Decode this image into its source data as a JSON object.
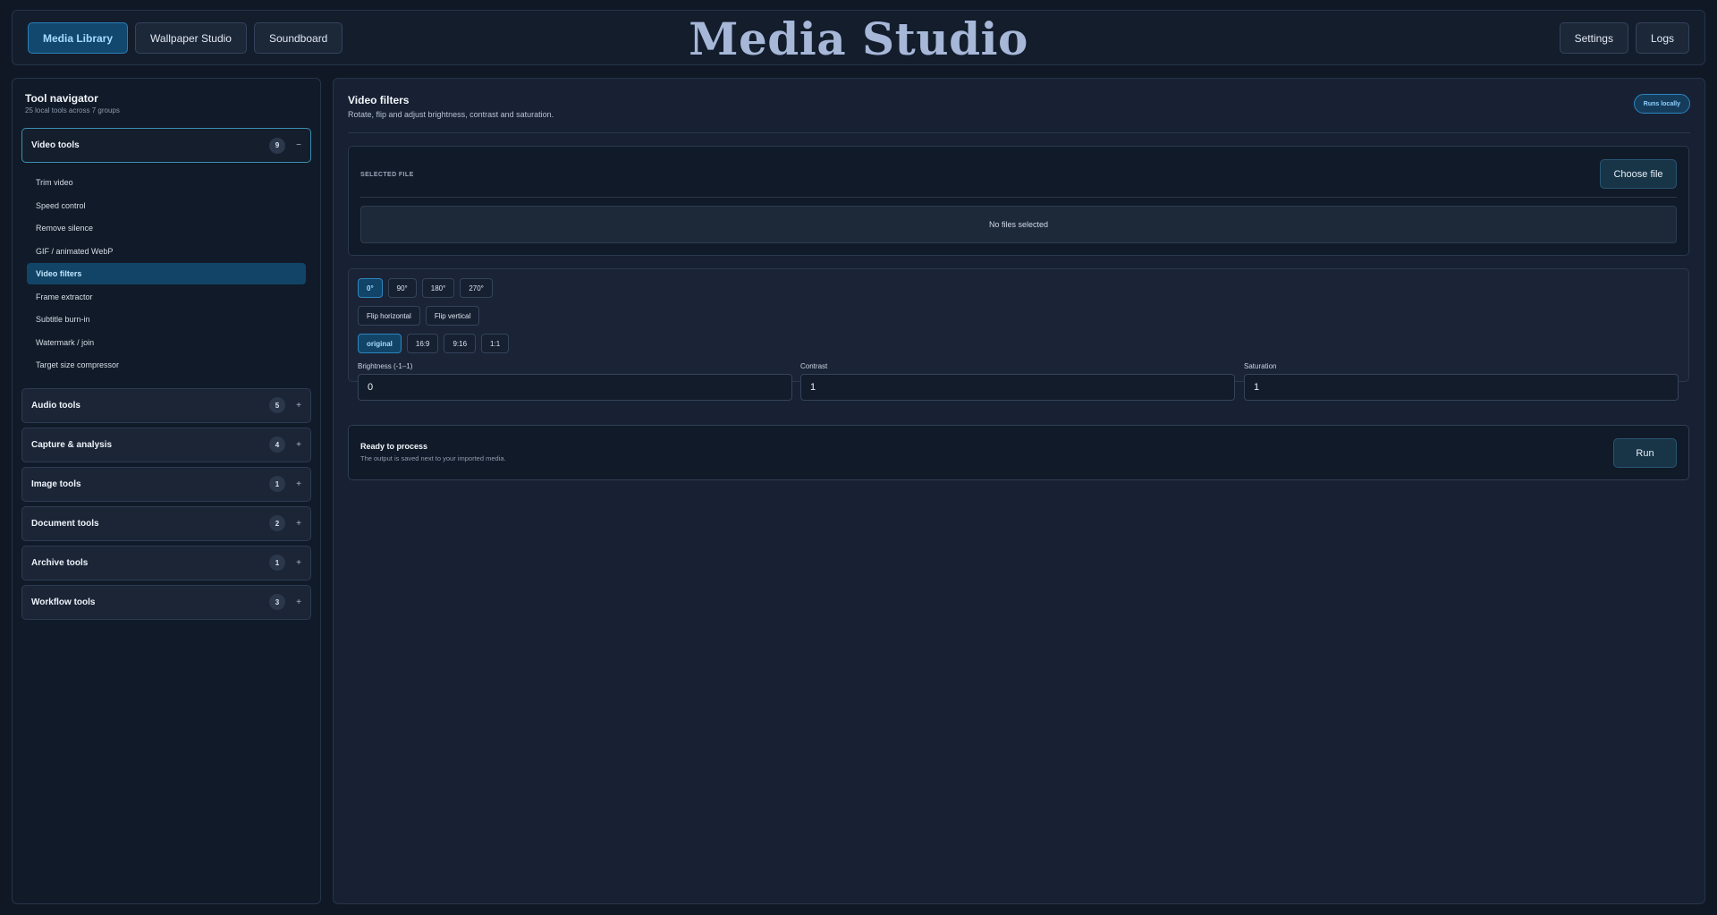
{
  "header": {
    "title": "Media Studio",
    "nav": [
      {
        "label": "Media Library",
        "active": true
      },
      {
        "label": "Wallpaper Studio",
        "active": false
      },
      {
        "label": "Soundboard",
        "active": false
      }
    ],
    "settings_label": "Settings",
    "logs_label": "Logs"
  },
  "sidebar": {
    "title": "Tool navigator",
    "subtitle": "25 local tools across 7 groups",
    "groups": [
      {
        "label": "Video tools",
        "count": "9",
        "toggle": "−",
        "open": true,
        "items": [
          "Trim video",
          "Speed control",
          "Remove silence",
          "GIF / animated WebP",
          "Video filters",
          "Frame extractor",
          "Subtitle burn-in",
          "Watermark / join",
          "Target size compressor"
        ],
        "active_item": "Video filters"
      },
      {
        "label": "Audio tools",
        "count": "5",
        "toggle": "+"
      },
      {
        "label": "Capture & analysis",
        "count": "4",
        "toggle": "+"
      },
      {
        "label": "Image tools",
        "count": "1",
        "toggle": "+"
      },
      {
        "label": "Document tools",
        "count": "2",
        "toggle": "+"
      },
      {
        "label": "Archive tools",
        "count": "1",
        "toggle": "+"
      },
      {
        "label": "Workflow tools",
        "count": "3",
        "toggle": "+"
      }
    ]
  },
  "main": {
    "title": "Video filters",
    "description": "Rotate, flip and adjust brightness, contrast and saturation.",
    "badge": "Runs locally",
    "file": {
      "label": "SELECTED FILE",
      "choose_label": "Choose file",
      "empty_text": "No files selected"
    },
    "rotation": {
      "options": [
        "0°",
        "90°",
        "180°",
        "270°"
      ],
      "selected": "0°"
    },
    "flip": {
      "options": [
        "Flip horizontal",
        "Flip vertical"
      ]
    },
    "aspect": {
      "options": [
        "original",
        "16:9",
        "9:16",
        "1:1"
      ],
      "selected": "original"
    },
    "fields": [
      {
        "label": "Brightness (-1–1)",
        "value": "0"
      },
      {
        "label": "Contrast",
        "value": "1"
      },
      {
        "label": "Saturation",
        "value": "1"
      }
    ],
    "run": {
      "title": "Ready to process",
      "subtitle": "The output is saved next to your imported media.",
      "button_label": "Run"
    }
  },
  "colors": {
    "accent": "#2b7db6",
    "background": "#101826",
    "panel": "#172133"
  }
}
